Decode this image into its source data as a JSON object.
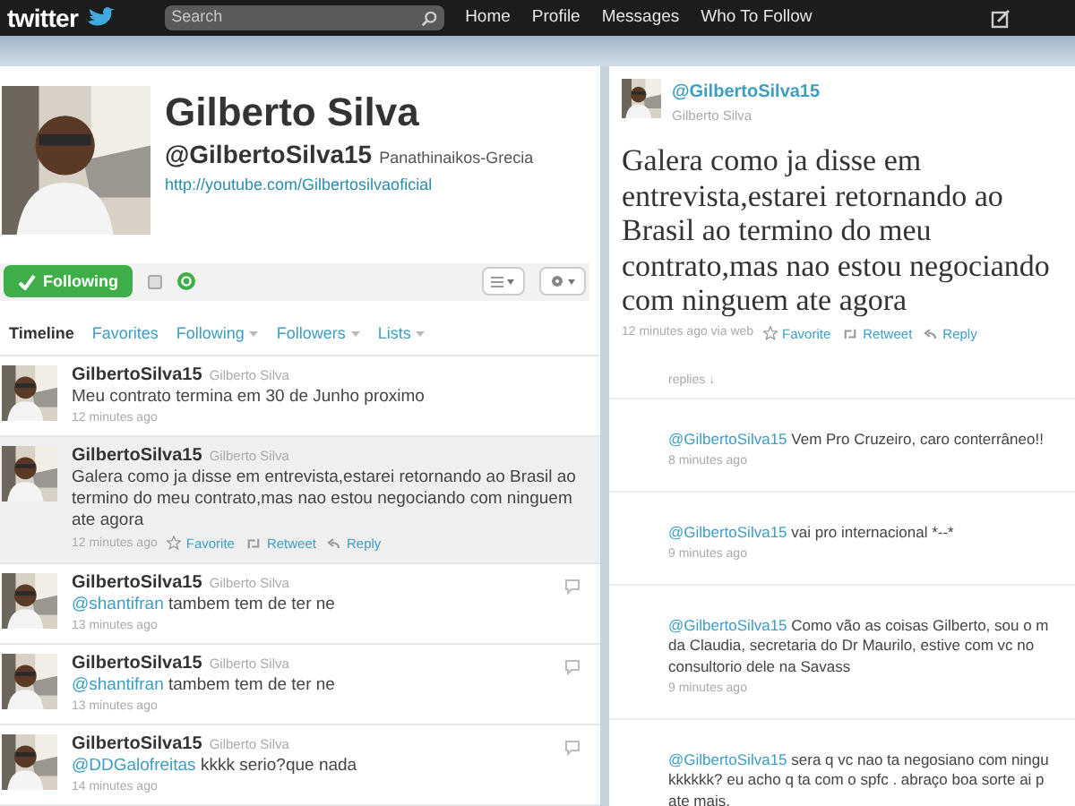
{
  "top_bar": {
    "logo": "twitter",
    "search": {
      "placeholder": "Search"
    },
    "nav": [
      {
        "label": "Home"
      },
      {
        "label": "Profile"
      },
      {
        "label": "Messages"
      },
      {
        "label": "Who To Follow"
      }
    ]
  },
  "profile": {
    "name": "Gilberto Silva",
    "handle": "@GilbertoSilva15",
    "location": "Panathinaikos-Grecia",
    "url": "http://youtube.com/Gilbertosilvaoficial"
  },
  "follow_button": {
    "label": "Following",
    "following": true
  },
  "tabs": [
    {
      "label": "Timeline",
      "selected": true,
      "has_menu": false
    },
    {
      "label": "Favorites",
      "selected": false,
      "has_menu": false
    },
    {
      "label": "Following",
      "selected": false,
      "has_menu": true
    },
    {
      "label": "Followers",
      "selected": false,
      "has_menu": true
    },
    {
      "label": "Lists",
      "selected": false,
      "has_menu": true
    }
  ],
  "tweets": [
    {
      "username": "GilbertoSilva15",
      "name": "Gilberto Silva",
      "text": "Meu contrato termina em 30 de Junho proximo",
      "time": "12 minutes ago",
      "selected": false,
      "has_replies": false
    },
    {
      "username": "GilbertoSilva15",
      "name": "Gilberto Silva",
      "text": "Galera como ja disse em entrevista,estarei retornando ao Brasil ao termino do meu contrato,mas nao estou negociando com ninguem ate agora",
      "time": "12 minutes ago",
      "selected": true,
      "has_replies": false
    },
    {
      "username": "GilbertoSilva15",
      "name": "Gilberto Silva",
      "mention": "@shantifran",
      "text": " tambem tem de ter ne",
      "time": "13 minutes ago",
      "selected": false,
      "has_replies": true
    },
    {
      "username": "GilbertoSilva15",
      "name": "Gilberto Silva",
      "mention": "@shantifran",
      "text": " tambem tem de ter ne",
      "time": "13 minutes ago",
      "selected": false,
      "has_replies": true
    },
    {
      "username": "GilbertoSilva15",
      "name": "Gilberto Silva",
      "mention": "@DDGalofreitas",
      "text": " kkkk serio?que nada",
      "time": "14 minutes ago",
      "selected": false,
      "has_replies": true
    }
  ],
  "tweet_actions": [
    "Favorite",
    "Retweet",
    "Reply"
  ],
  "detail": {
    "handle": "@GilbertoSilva15",
    "name": "Gilberto Silva",
    "text": "Galera como ja disse em entrevista,estarei retornando ao Brasil ao termino do meu contrato,mas nao estou negociando com ninguem ate agora",
    "time": "12 minutes ago via web",
    "actions": [
      "Favorite",
      "Retweet",
      "Reply"
    ],
    "replies_label": "replies ↓",
    "replies": [
      {
        "mention": "@GilbertoSilva15",
        "text": " Vem Pro Cruzeiro, caro conterrâneo!!",
        "time": "8 minutes ago"
      },
      {
        "mention": "@GilbertoSilva15",
        "text": " vai pro internacional *--*",
        "time": "9 minutes ago"
      },
      {
        "mention": "@GilbertoSilva15",
        "text": " Como vão as coisas Gilberto, sou o m\nda Claudia, secretaria do Dr Maurilo, estive com vc no\nconsultorio dele na Savass",
        "time": "9 minutes ago"
      },
      {
        "mention": "@GilbertoSilva15",
        "text": " sera q vc nao ta negosiano com ningu\nkkkkkk? eu acho q ta com o spfc . abraço boa sorte ai p\nate mais."
      }
    ]
  }
}
